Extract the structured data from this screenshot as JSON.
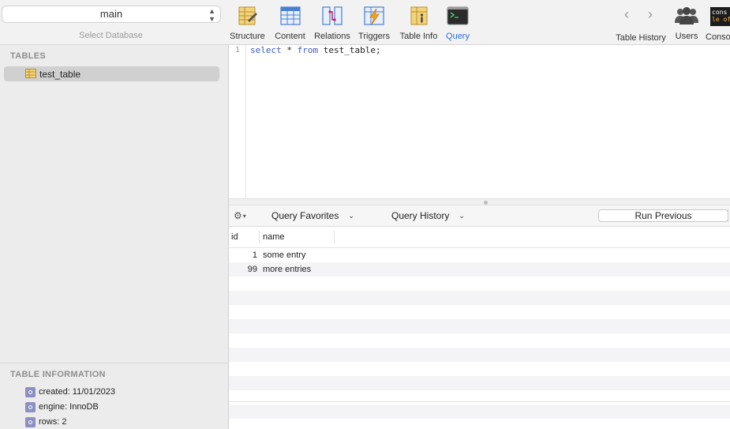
{
  "database": {
    "selected": "main",
    "caption": "Select Database"
  },
  "toolbar": {
    "items": [
      {
        "label": "Structure",
        "icon": "structure-icon"
      },
      {
        "label": "Content",
        "icon": "content-icon"
      },
      {
        "label": "Relations",
        "icon": "relations-icon"
      },
      {
        "label": "Triggers",
        "icon": "triggers-icon"
      },
      {
        "label": "Table Info",
        "icon": "table-info-icon"
      },
      {
        "label": "Query",
        "icon": "query-icon",
        "active": true
      }
    ],
    "right": [
      {
        "label": "Table History",
        "icon": "history-nav-icon"
      },
      {
        "label": "Users",
        "icon": "users-icon"
      },
      {
        "label": "Conso",
        "icon": "console-icon"
      }
    ],
    "console_icon_text": [
      "cons",
      "le of"
    ]
  },
  "sidebar": {
    "tables_heading": "TABLES",
    "tables": [
      {
        "name": "test_table"
      }
    ],
    "info_heading": "TABLE INFORMATION",
    "info": [
      "created: 11/01/2023",
      "engine: InnoDB",
      "rows: 2"
    ]
  },
  "editor": {
    "line_number": "1",
    "query": {
      "kw1": "select",
      "star": " * ",
      "kw2": "from",
      "rest": " test_table;"
    }
  },
  "querybar": {
    "favorites": "Query Favorites",
    "history": "Query History",
    "run_previous": "Run Previous"
  },
  "results": {
    "columns": [
      "id",
      "name"
    ],
    "rows": [
      {
        "id": "1",
        "name": "some entry"
      },
      {
        "id": "99",
        "name": "more entries"
      }
    ]
  },
  "colors": {
    "accent": "#2f6ee0",
    "keyword": "#3b5ac5",
    "sidebar": "#ececec"
  }
}
